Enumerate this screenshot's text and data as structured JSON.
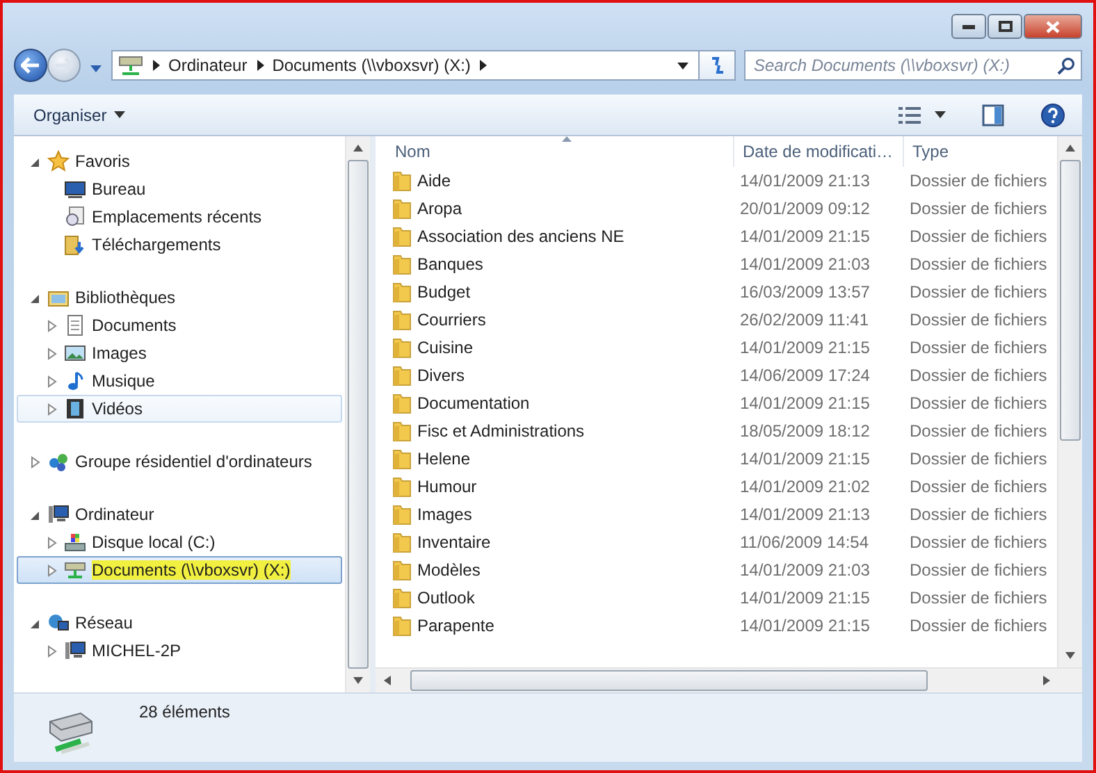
{
  "address_bar": {
    "segments": [
      "Ordinateur",
      "Documents (\\\\vboxsvr) (X:)"
    ]
  },
  "search": {
    "placeholder": "Search Documents (\\\\vboxsvr) (X:)"
  },
  "toolbar": {
    "organize": "Organiser"
  },
  "navigation": [
    {
      "label": "Favoris",
      "kind": "star",
      "expandable": true,
      "expanded": true,
      "selected": false,
      "hovered": false,
      "children": [
        {
          "label": "Bureau",
          "kind": "desktop",
          "selected": false,
          "hovered": false
        },
        {
          "label": "Emplacements récents",
          "kind": "recent",
          "selected": false,
          "hovered": false
        },
        {
          "label": "Téléchargements",
          "kind": "downloads",
          "selected": false,
          "hovered": false
        }
      ]
    },
    {
      "label": "Bibliothèques",
      "kind": "library",
      "expandable": true,
      "expanded": true,
      "selected": false,
      "hovered": false,
      "children": [
        {
          "label": "Documents",
          "kind": "document",
          "expandable": true,
          "expanded": false,
          "selected": false,
          "hovered": false
        },
        {
          "label": "Images",
          "kind": "picture",
          "expandable": true,
          "expanded": false,
          "selected": false,
          "hovered": false
        },
        {
          "label": "Musique",
          "kind": "music",
          "expandable": true,
          "expanded": false,
          "selected": false,
          "hovered": false
        },
        {
          "label": "Vidéos",
          "kind": "video",
          "expandable": true,
          "expanded": false,
          "selected": false,
          "hovered": true
        }
      ]
    },
    {
      "label": "Groupe résidentiel d'ordinateurs",
      "kind": "homegroup",
      "expandable": true,
      "expanded": false,
      "selected": false,
      "hovered": false
    },
    {
      "label": "Ordinateur",
      "kind": "computer",
      "expandable": true,
      "expanded": true,
      "selected": false,
      "hovered": false,
      "children": [
        {
          "label": "Disque local (C:)",
          "kind": "disk",
          "expandable": true,
          "expanded": false,
          "selected": false,
          "hovered": false
        },
        {
          "label": "Documents (\\\\vboxsvr) (X:)",
          "kind": "netdrive",
          "expandable": true,
          "expanded": false,
          "selected": true,
          "hovered": false
        }
      ]
    },
    {
      "label": "Réseau",
      "kind": "network",
      "expandable": true,
      "expanded": true,
      "selected": false,
      "hovered": false,
      "children": [
        {
          "label": "MICHEL-2P",
          "kind": "computer",
          "expandable": true,
          "expanded": false,
          "selected": false,
          "hovered": false
        }
      ]
    }
  ],
  "file_list": {
    "columns": [
      "Nom",
      "Date de modificati…",
      "Type"
    ],
    "rows": [
      {
        "name": "Aide",
        "date": "14/01/2009 21:13",
        "type": "Dossier de fichiers"
      },
      {
        "name": "Aropa",
        "date": "20/01/2009 09:12",
        "type": "Dossier de fichiers"
      },
      {
        "name": "Association des anciens NE",
        "date": "14/01/2009 21:15",
        "type": "Dossier de fichiers"
      },
      {
        "name": "Banques",
        "date": "14/01/2009 21:03",
        "type": "Dossier de fichiers"
      },
      {
        "name": "Budget",
        "date": "16/03/2009 13:57",
        "type": "Dossier de fichiers"
      },
      {
        "name": "Courriers",
        "date": "26/02/2009 11:41",
        "type": "Dossier de fichiers"
      },
      {
        "name": "Cuisine",
        "date": "14/01/2009 21:15",
        "type": "Dossier de fichiers"
      },
      {
        "name": "Divers",
        "date": "14/06/2009 17:24",
        "type": "Dossier de fichiers"
      },
      {
        "name": "Documentation",
        "date": "14/01/2009 21:15",
        "type": "Dossier de fichiers"
      },
      {
        "name": "Fisc et Administrations",
        "date": "18/05/2009 18:12",
        "type": "Dossier de fichiers"
      },
      {
        "name": "Helene",
        "date": "14/01/2009 21:15",
        "type": "Dossier de fichiers"
      },
      {
        "name": "Humour",
        "date": "14/01/2009 21:02",
        "type": "Dossier de fichiers"
      },
      {
        "name": "Images",
        "date": "14/01/2009 21:13",
        "type": "Dossier de fichiers"
      },
      {
        "name": "Inventaire",
        "date": "11/06/2009 14:54",
        "type": "Dossier de fichiers"
      },
      {
        "name": "Modèles",
        "date": "14/01/2009 21:03",
        "type": "Dossier de fichiers"
      },
      {
        "name": "Outlook",
        "date": "14/01/2009 21:15",
        "type": "Dossier de fichiers"
      },
      {
        "name": "Parapente",
        "date": "14/01/2009 21:15",
        "type": "Dossier de fichiers"
      }
    ]
  },
  "status_bar": {
    "text": "28 éléments"
  }
}
